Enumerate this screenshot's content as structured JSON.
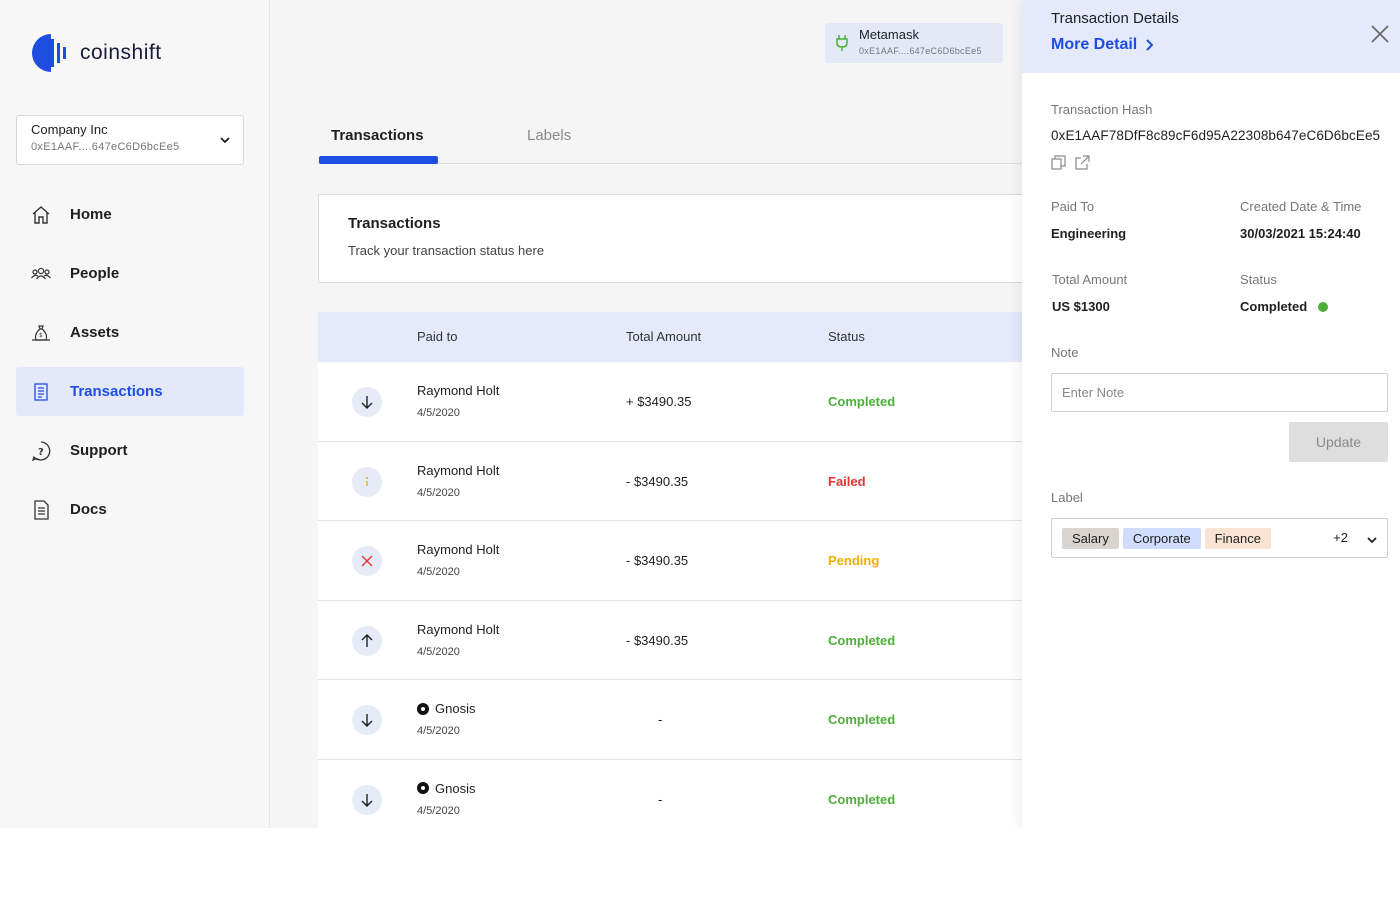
{
  "brand": {
    "name": "coinshift",
    "color": "#1f4de2"
  },
  "org": {
    "name": "Company Inc",
    "address": "0xE1AAF....647eC6D6bcEe5"
  },
  "nav": [
    {
      "label": "Home",
      "icon": "home-icon"
    },
    {
      "label": "People",
      "icon": "people-icon"
    },
    {
      "label": "Assets",
      "icon": "assets-icon"
    },
    {
      "label": "Transactions",
      "icon": "transactions-icon",
      "active": true
    },
    {
      "label": "Support",
      "icon": "support-icon"
    },
    {
      "label": "Docs",
      "icon": "docs-icon"
    }
  ],
  "wallet": {
    "name": "Metamask",
    "address": "0xE1AAF....647eC6D6bcEe5",
    "icon": "plug-icon"
  },
  "tabs": {
    "transactions": "Transactions",
    "labels": "Labels"
  },
  "card": {
    "title": "Transactions",
    "subtitle": "Track your transaction status here"
  },
  "table": {
    "headers": {
      "paid_to": "Paid to",
      "total_amount": "Total Amount",
      "status": "Status"
    },
    "rows": [
      {
        "icon": "arrow-down-icon",
        "name": "Raymond Holt",
        "date": "4/5/2020",
        "amount": "+ $3490.35",
        "status": "Completed"
      },
      {
        "icon": "info-icon",
        "name": "Raymond Holt",
        "date": "4/5/2020",
        "amount": "- $3490.35",
        "status": "Failed"
      },
      {
        "icon": "x-icon",
        "name": "Raymond Holt",
        "date": "4/5/2020",
        "amount": "- $3490.35",
        "status": "Pending"
      },
      {
        "icon": "arrow-up-icon",
        "name": "Raymond Holt",
        "date": "4/5/2020",
        "amount": "- $3490.35",
        "status": "Completed"
      },
      {
        "icon": "arrow-down-icon",
        "name": "Gnosis",
        "date": "4/5/2020",
        "amount": "-",
        "status": "Completed"
      },
      {
        "icon": "arrow-down-icon",
        "name": "Gnosis",
        "date": "4/5/2020",
        "amount": "-",
        "status": "Completed"
      }
    ]
  },
  "details": {
    "title": "Transaction Details",
    "more_detail": "More Detail",
    "hash_label": "Transaction Hash",
    "hash": "0xE1AAF78DfF8c89cF6d95A22308b647eC6D6bcEe5",
    "paid_to_label": "Paid To",
    "paid_to": "Engineering",
    "created_label": "Created Date & Time",
    "created": "30/03/2021 15:24:40",
    "amount_label": "Total Amount",
    "amount": "US $1300",
    "status_label": "Status",
    "status": "Completed",
    "note_label": "Note",
    "note_placeholder": "Enter Note",
    "note_value": "",
    "update": "Update",
    "label_label": "Label",
    "labels": [
      "Salary",
      "Corporate",
      "Finance"
    ],
    "labels_more": "+2"
  },
  "colors": {
    "completed": "#4caf38",
    "failed": "#e53535",
    "pending": "#f0b000",
    "accent": "#1f4de2"
  }
}
